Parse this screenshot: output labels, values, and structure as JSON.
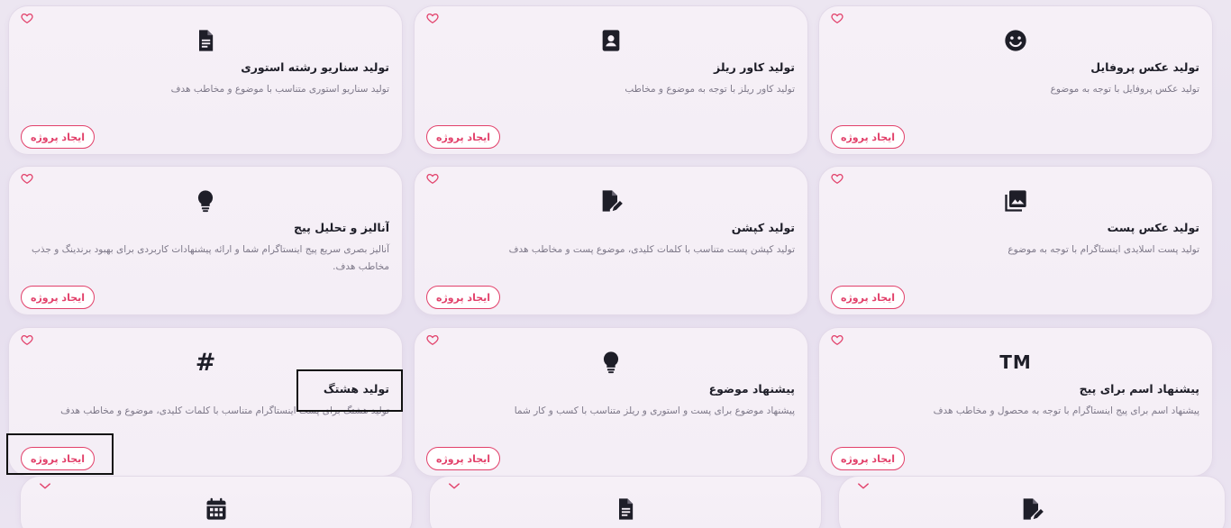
{
  "labels": {
    "create_project": "ایجاد پروژه"
  },
  "colors": {
    "accent": "#e2406a",
    "icon": "#1e1e28",
    "muted_text": "#7d7888"
  },
  "cards": [
    {
      "id": "profile-photo",
      "icon": "smile-icon",
      "title": "تولید عکس پروفایل",
      "desc": "تولید عکس پروفایل با توجه به موضوع"
    },
    {
      "id": "reels-cover",
      "icon": "contact-card-icon",
      "title": "تولید کاور ریلز",
      "desc": "تولید کاور ریلز با توجه به موضوع و مخاطب"
    },
    {
      "id": "story-script",
      "icon": "document-icon",
      "title": "تولید سناریو رشته استوری",
      "desc": "تولید سناریو استوری متناسب با موضوع و مخاطب هدف"
    },
    {
      "id": "post-photo",
      "icon": "photo-library-icon",
      "title": "تولید عکس پست",
      "desc": "تولید پست اسلایدی اینستاگرام با توجه به موضوع"
    },
    {
      "id": "caption",
      "icon": "edit-document-icon",
      "title": "تولید کپشن",
      "desc": "تولید کپشن پست متناسب با کلمات کلیدی، موضوع پست و مخاطب هدف"
    },
    {
      "id": "page-analysis",
      "icon": "lightbulb-icon",
      "title": "آنالیز و تحلیل پیج",
      "desc": "آنالیز بصری سریع پیج اینستاگرام شما و ارائه پیشنهادات کاربردی برای بهبود برندینگ و جذب مخاطب هدف."
    },
    {
      "id": "page-name",
      "icon": "trademark-icon",
      "icon_text": "TM",
      "title": "پیشنهاد اسم برای پیج",
      "desc": "پیشنهاد اسم برای پیج اینستاگرام با توجه به محصول و مخاطب هدف"
    },
    {
      "id": "topic",
      "icon": "lightbulb-icon",
      "title": "پیشنهاد موضوع",
      "desc": "پیشنهاد موضوع برای پست و استوری و ریلز متناسب با کسب و کار شما"
    },
    {
      "id": "hashtag",
      "icon": "hashtag-icon",
      "icon_text": "#",
      "title": "تولید هشتگ",
      "desc": "تولید هشتگ برای پست اینستاگرام متناسب با کلمات کلیدی، موضوع و مخاطب هدف"
    }
  ],
  "partial_cards": [
    {
      "icon": "edit-document-icon"
    },
    {
      "icon": "document-icon"
    },
    {
      "icon": "calendar-icon"
    }
  ]
}
